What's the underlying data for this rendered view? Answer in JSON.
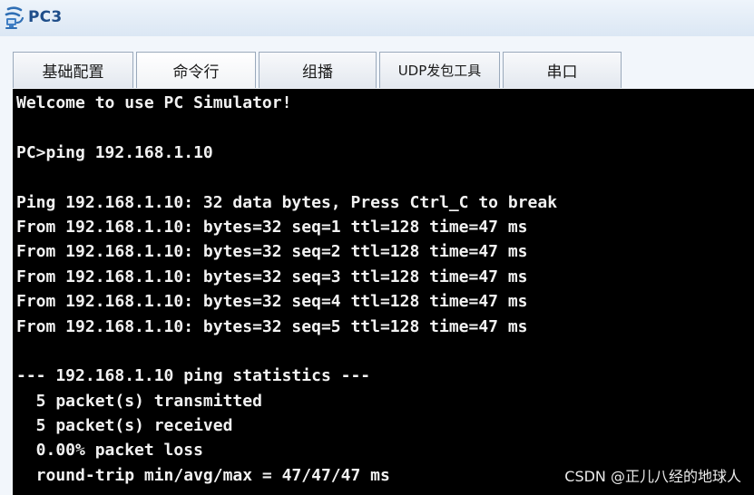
{
  "window": {
    "title": "PC3",
    "icon": "pc-network-icon"
  },
  "tabs": [
    {
      "label": "基础配置",
      "active": false
    },
    {
      "label": "命令行",
      "active": true
    },
    {
      "label": "组播",
      "active": false
    },
    {
      "label": "UDP发包工具",
      "active": false
    },
    {
      "label": "串口",
      "active": false
    }
  ],
  "terminal": {
    "lines": [
      "Welcome to use PC Simulator!",
      "",
      "PC>ping 192.168.1.10",
      "",
      "Ping 192.168.1.10: 32 data bytes, Press Ctrl_C to break",
      "From 192.168.1.10: bytes=32 seq=1 ttl=128 time=47 ms",
      "From 192.168.1.10: bytes=32 seq=2 ttl=128 time=47 ms",
      "From 192.168.1.10: bytes=32 seq=3 ttl=128 time=47 ms",
      "From 192.168.1.10: bytes=32 seq=4 ttl=128 time=47 ms",
      "From 192.168.1.10: bytes=32 seq=5 ttl=128 time=47 ms",
      "",
      "--- 192.168.1.10 ping statistics ---",
      "  5 packet(s) transmitted",
      "  5 packet(s) received",
      "  0.00% packet loss",
      "  round-trip min/avg/max = 47/47/47 ms"
    ]
  },
  "watermark": "CSDN @正儿八经的地球人",
  "colors": {
    "terminal_bg": "#000000",
    "terminal_fg": "#f2f2f2",
    "title_text": "#1f4e8a"
  }
}
